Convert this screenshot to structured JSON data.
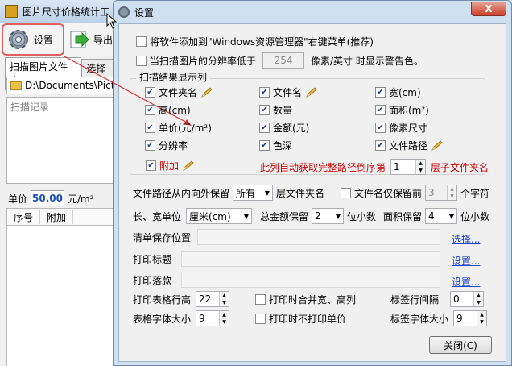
{
  "background_app": {
    "title": "图片尺寸价格统计工",
    "toolbar": {
      "settings_label": "设置",
      "export_label": "导出"
    },
    "tabs": [
      "扫描图片文件夹",
      "选择图"
    ],
    "path": "D:\\Documents\\Pict",
    "log_placeholder": "扫描记录",
    "price_label": "单价",
    "price_value": "50.00",
    "price_unit": "元/m²",
    "list_columns": [
      "序号",
      "附加"
    ]
  },
  "dialog": {
    "title": "设置",
    "close_label": "X",
    "context_menu_label": "将软件添加到\"Windows资源管理器\"右键菜单(推荐)",
    "resolution_warn": {
      "prefix": "当扫描图片的分辨率低于",
      "value": "254",
      "suffix": "像素/英寸 时显示警告色。"
    },
    "group_title": "扫描结果显示列",
    "columns": [
      {
        "label": "文件夹名",
        "checked": true,
        "editable": true
      },
      {
        "label": "文件名",
        "checked": true,
        "editable": true
      },
      {
        "label": "宽(cm)",
        "checked": true,
        "editable": false
      },
      {
        "label": "高(cm)",
        "checked": true,
        "editable": false
      },
      {
        "label": "数量",
        "checked": true,
        "editable": false
      },
      {
        "label": "面积(m²)",
        "checked": true,
        "editable": false
      },
      {
        "label": "单价(元/m²)",
        "checked": true,
        "editable": false
      },
      {
        "label": "金额(元)",
        "checked": true,
        "editable": false
      },
      {
        "label": "像素尺寸",
        "checked": true,
        "editable": false
      },
      {
        "label": "分辨率",
        "checked": true,
        "editable": false
      },
      {
        "label": "色深",
        "checked": true,
        "editable": false
      },
      {
        "label": "文件路径",
        "checked": true,
        "editable": true
      },
      {
        "label": "附加",
        "checked": true,
        "editable": true
      }
    ],
    "extra_column_note": "此列自动获取完整路径倒序第",
    "extra_level_value": "1",
    "extra_level_suffix": "层子文件夹名",
    "path_keep": {
      "prefix": "文件路径从内向外保留",
      "value": "所有",
      "suffix": "层文件夹名"
    },
    "filename_keep": {
      "label": "文件名仅保留前",
      "value": "3",
      "suffix": "个字符"
    },
    "units": {
      "label": "长、宽单位",
      "value": "厘米(cm)"
    },
    "total_decimals": {
      "label": "总金额保留",
      "value": "2",
      "suffix": "位小数"
    },
    "area_decimals": {
      "label": "面积保留",
      "value": "4",
      "suffix": "位小数"
    },
    "save_location": {
      "label": "清单保存位置",
      "value": "",
      "action": "选择..."
    },
    "print_title": {
      "label": "打印标题",
      "value": "",
      "action": "设置..."
    },
    "print_footer": {
      "label": "打印落款",
      "value": "",
      "action": "设置..."
    },
    "print_row_height": {
      "label": "打印表格行高",
      "value": "22"
    },
    "merge_wh": "打印时合并宽、高列",
    "label_spacing": {
      "label": "标签行间隔",
      "value": "0"
    },
    "table_font_size": {
      "label": "表格字体大小",
      "value": "9"
    },
    "no_print_price": "打印时不打印单价",
    "label_font_size": {
      "label": "标签字体大小",
      "value": "9"
    },
    "close_button": "关闭(C)"
  },
  "colors": {
    "accent_red": "#c80000",
    "link_blue": "#1a44c8",
    "arrow_red": "#e03030"
  }
}
